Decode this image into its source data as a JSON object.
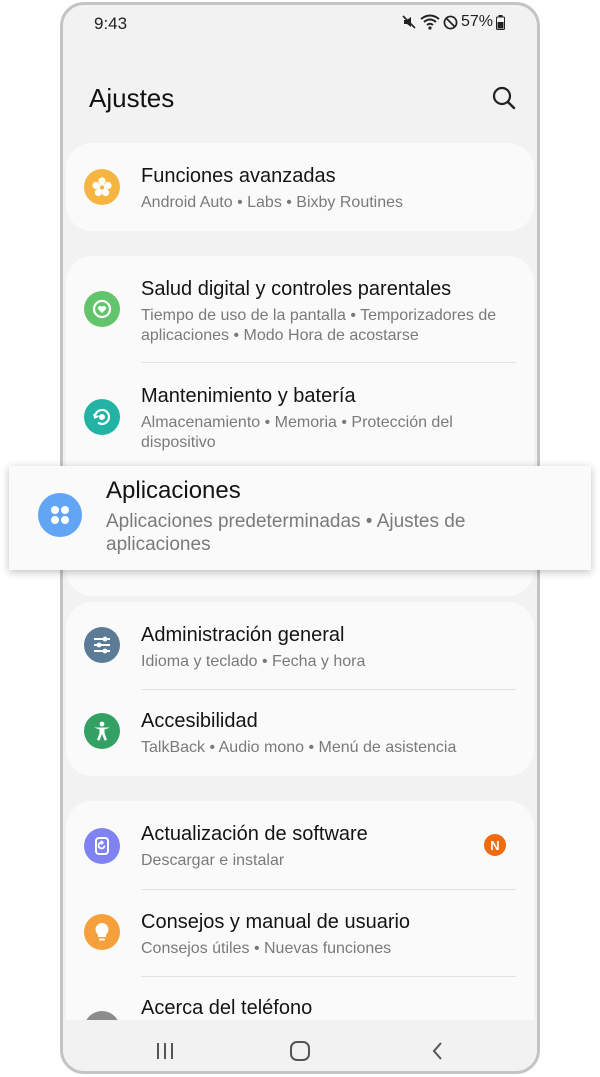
{
  "status_bar": {
    "time": "9:43",
    "battery": "57%"
  },
  "header": {
    "title": "Ajustes"
  },
  "colors": {
    "funciones": "#f5b540",
    "salud": "#62c46b",
    "mantenimiento": "#22b3a4",
    "aplicaciones": "#62a5f4",
    "administracion": "#5b7b97",
    "accesibilidad": "#33a064",
    "actualizacion": "#7f83f2",
    "consejos": "#f6a03c",
    "acerca": "#8c8c8c",
    "badge": "#f06a10"
  },
  "settings": {
    "funciones": {
      "title": "Funciones avanzadas",
      "subtitle": "Android Auto  •  Labs  •  Bixby Routines",
      "icon": "star-gear-icon"
    },
    "salud": {
      "title": "Salud digital y controles parentales",
      "subtitle": "Tiempo de uso de la pantalla  •  Temporizadores de aplicaciones  •  Modo Hora de acostarse",
      "icon": "digital-wellbeing-icon"
    },
    "mantenimiento": {
      "title": "Mantenimiento y batería",
      "subtitle": "Almacenamiento  •  Memoria  •  Protección del dispositivo",
      "icon": "device-care-icon"
    },
    "aplicaciones": {
      "title": "Aplicaciones",
      "subtitle": "Aplicaciones predeterminadas  •  Ajustes de aplicaciones",
      "icon": "apps-grid-icon"
    },
    "administracion": {
      "title": "Administración general",
      "subtitle": "Idioma y teclado  •  Fecha y hora",
      "icon": "sliders-icon"
    },
    "accesibilidad": {
      "title": "Accesibilidad",
      "subtitle": "TalkBack  •  Audio mono  •  Menú de asistencia",
      "icon": "accessibility-icon"
    },
    "actualizacion": {
      "title": "Actualización de software",
      "subtitle": "Descargar e instalar",
      "icon": "software-update-icon",
      "badge": "N"
    },
    "consejos": {
      "title": "Consejos y manual de usuario",
      "subtitle": "Consejos útiles  •  Nuevas funciones",
      "icon": "lightbulb-icon"
    },
    "acerca": {
      "title": "Acerca del teléfono",
      "icon": "info-icon"
    }
  }
}
